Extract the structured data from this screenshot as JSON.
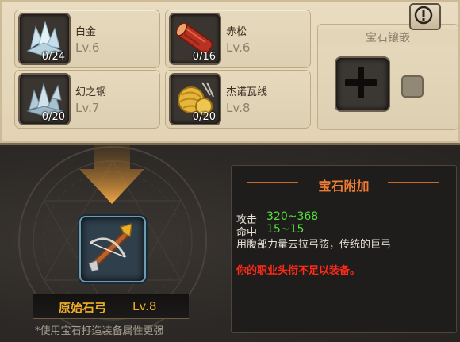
{
  "materials": [
    {
      "icon": "crystal-icon",
      "name": "白金",
      "count": "0/24",
      "level": "Lv.6"
    },
    {
      "icon": "wood-log-icon",
      "name": "赤松",
      "count": "0/16",
      "level": "Lv.6"
    },
    {
      "icon": "ice-crystal-icon",
      "name": "幻之钢",
      "count": "0/20",
      "level": "Lv.7"
    },
    {
      "icon": "yarn-ball-icon",
      "name": "杰诺瓦线",
      "count": "0/20",
      "level": "Lv.8"
    }
  ],
  "gem_socket": {
    "title": "宝石镶嵌"
  },
  "gem_bonus": {
    "title": "宝石附加",
    "stats": [
      {
        "label": "攻击",
        "value": "320~368"
      },
      {
        "label": "命中",
        "value": "15~15"
      }
    ],
    "description": "用腹部力量去拉弓弦，传统的巨弓",
    "warning": "你的职业头衔不足以装备。"
  },
  "item": {
    "name": "原始石弓",
    "level": "Lv.8",
    "icon": "crossbow-icon"
  },
  "hint": "*使用宝石打造装备属性更强",
  "colors": {
    "parchment": "#e6d9bd",
    "dark_bg": "#2d2a27",
    "stat_green": "#53e23a",
    "warning_red": "#ff2a18",
    "title_orange": "#f07c33",
    "item_gold": "#f1b028"
  }
}
